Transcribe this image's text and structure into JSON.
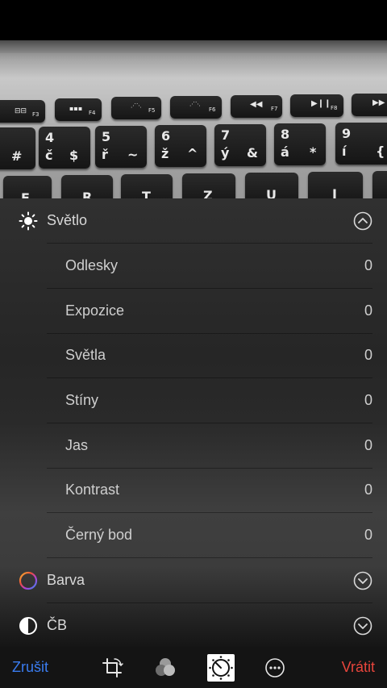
{
  "keyboard": {
    "fn_keys": [
      {
        "label": "F3"
      },
      {
        "label": "F4"
      },
      {
        "label": "F5"
      },
      {
        "label": "F6"
      },
      {
        "label": "F7"
      },
      {
        "label": "F8"
      }
    ],
    "num_keys": [
      {
        "top": "",
        "bottom": "#"
      },
      {
        "top": "4",
        "bottom": "č",
        "alt": "$"
      },
      {
        "top": "5",
        "bottom": "ř",
        "alt": "~"
      },
      {
        "top": "6",
        "bottom": "ž",
        "alt": "^"
      },
      {
        "top": "7",
        "bottom": "ý",
        "alt": "&"
      },
      {
        "top": "8",
        "bottom": "á",
        "alt": "*"
      },
      {
        "top": "9",
        "bottom": "í",
        "alt": "{"
      }
    ],
    "letter_keys": [
      "E",
      "R",
      "T",
      "Z",
      "U",
      "I"
    ]
  },
  "light_section": {
    "label": "Světlo",
    "icon": "sun-icon",
    "expanded": true,
    "items": [
      {
        "label": "Odlesky",
        "value": "0"
      },
      {
        "label": "Expozice",
        "value": "0"
      },
      {
        "label": "Světla",
        "value": "0"
      },
      {
        "label": "Stíny",
        "value": "0"
      },
      {
        "label": "Jas",
        "value": "0"
      },
      {
        "label": "Kontrast",
        "value": "0"
      },
      {
        "label": "Černý bod",
        "value": "0"
      }
    ]
  },
  "color_section": {
    "label": "Barva",
    "icon": "color-wheel-icon",
    "expanded": false
  },
  "bw_section": {
    "label": "ČB",
    "icon": "half-circle-icon",
    "expanded": false
  },
  "toolbar": {
    "cancel_label": "Zrušit",
    "revert_label": "Vrátit",
    "cancel_color": "#3a7cf0",
    "revert_color": "#e8453c",
    "tools": [
      "crop-rotate-icon",
      "filters-icon",
      "adjust-dial-icon",
      "more-icon"
    ],
    "active_tool": "adjust-dial-icon"
  }
}
